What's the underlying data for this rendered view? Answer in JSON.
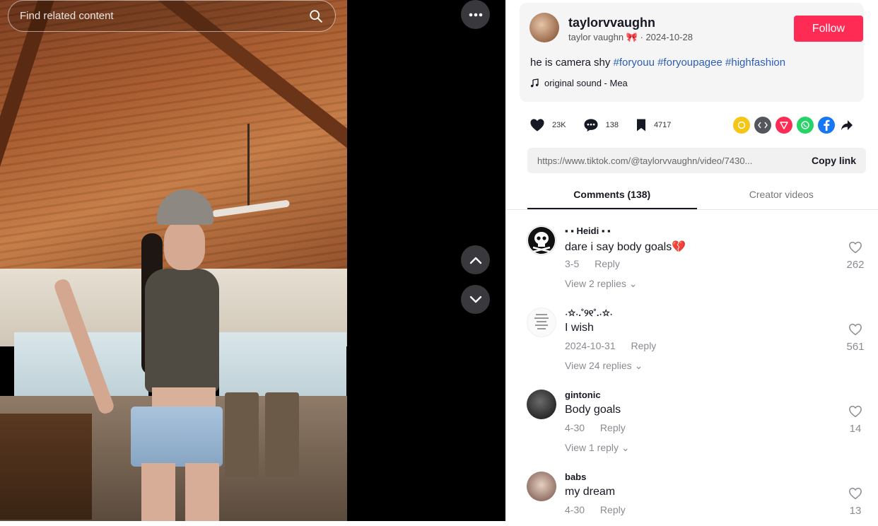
{
  "video": {
    "search_placeholder": "Find related content"
  },
  "post": {
    "username": "taylorvvaughn",
    "display_name": "taylor vaughn 🎀",
    "date": "2024-10-28",
    "follow_label": "Follow",
    "caption_text": "he is camera shy ",
    "hashtags": [
      "#foryouu",
      "#foryoupagee",
      "#highfashion"
    ],
    "music": "original sound - Mea"
  },
  "actions": {
    "likes": "23K",
    "comments": "138",
    "saves": "4717"
  },
  "share_icons": [
    "coin-icon",
    "embed-icon",
    "send-icon",
    "whatsapp-icon",
    "facebook-icon",
    "share-arrow-icon"
  ],
  "link": {
    "url": "https://www.tiktok.com/@taylorvvaughn/video/7430...",
    "copy_label": "Copy link"
  },
  "tabs": [
    {
      "label": "Comments (138)",
      "active": true
    },
    {
      "label": "Creator videos",
      "active": false
    }
  ],
  "comments": [
    {
      "name": "▪ ▪ Heidi ▪ ▪",
      "text": "dare i say body goals💔",
      "date": "3-5",
      "reply": "Reply",
      "replies": "View 2 replies ⌄",
      "likes": "262"
    },
    {
      "name": "˖✩˖.˚୨୧˚.˖✩˖",
      "text": "I wish",
      "date": "2024-10-31",
      "reply": "Reply",
      "replies": "View 24 replies ⌄",
      "likes": "561"
    },
    {
      "name": "gintonic",
      "text": "Body goals",
      "date": "4-30",
      "reply": "Reply",
      "replies": "View 1 reply ⌄",
      "likes": "14"
    },
    {
      "name": "babs",
      "text": "my dream",
      "date": "4-30",
      "reply": "Reply",
      "replies": "",
      "likes": "13"
    }
  ]
}
